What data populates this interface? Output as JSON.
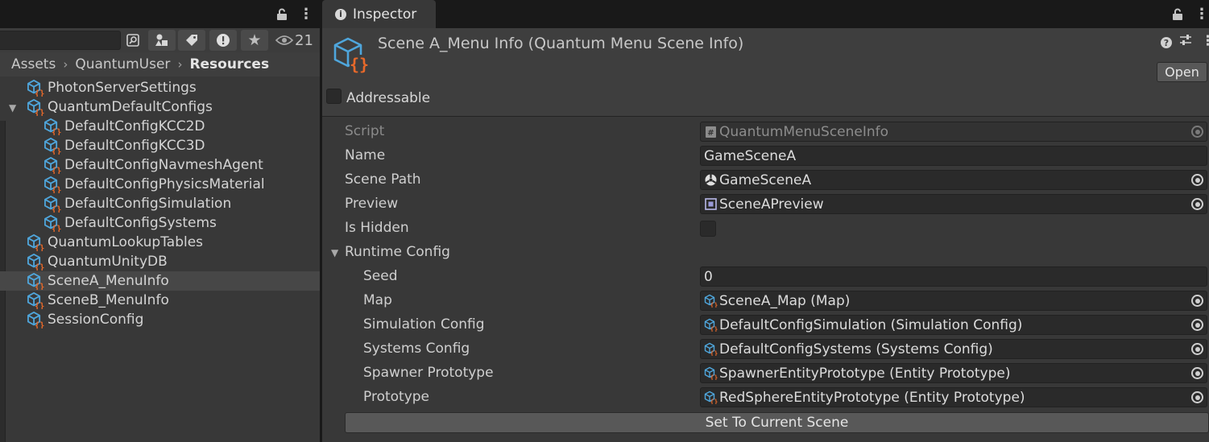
{
  "project_panel": {
    "visible_count": "21",
    "search": {
      "value": "",
      "placeholder": ""
    },
    "breadcrumb": [
      "Assets",
      "QuantumUser",
      "Resources"
    ],
    "tree": [
      {
        "label": "PhotonServerSettings",
        "depth": 0,
        "expanded": false,
        "selected": false
      },
      {
        "label": "QuantumDefaultConfigs",
        "depth": 0,
        "expanded": true,
        "selected": false
      },
      {
        "label": "DefaultConfigKCC2D",
        "depth": 1,
        "expanded": false,
        "selected": false
      },
      {
        "label": "DefaultConfigKCC3D",
        "depth": 1,
        "expanded": false,
        "selected": false
      },
      {
        "label": "DefaultConfigNavmeshAgent",
        "depth": 1,
        "expanded": false,
        "selected": false
      },
      {
        "label": "DefaultConfigPhysicsMaterial",
        "depth": 1,
        "expanded": false,
        "selected": false
      },
      {
        "label": "DefaultConfigSimulation",
        "depth": 1,
        "expanded": false,
        "selected": false
      },
      {
        "label": "DefaultConfigSystems",
        "depth": 1,
        "expanded": false,
        "selected": false
      },
      {
        "label": "QuantumLookupTables",
        "depth": 0,
        "expanded": false,
        "selected": false
      },
      {
        "label": "QuantumUnityDB",
        "depth": 0,
        "expanded": false,
        "selected": false
      },
      {
        "label": "SceneA_MenuInfo",
        "depth": 0,
        "expanded": false,
        "selected": true
      },
      {
        "label": "SceneB_MenuInfo",
        "depth": 0,
        "expanded": false,
        "selected": false
      },
      {
        "label": "SessionConfig",
        "depth": 0,
        "expanded": false,
        "selected": false
      }
    ]
  },
  "inspector": {
    "tab_label": "Inspector",
    "title": "Scene A_Menu Info (Quantum Menu Scene Info)",
    "open_label": "Open",
    "addressable_label": "Addressable",
    "addressable_checked": false,
    "properties": {
      "script": {
        "label": "Script",
        "value": "QuantumMenuSceneInfo",
        "icon": "script-icon"
      },
      "name": {
        "label": "Name",
        "value": "GameSceneA"
      },
      "scene_path": {
        "label": "Scene Path",
        "value": "GameSceneA",
        "icon": "unity-scene-icon"
      },
      "preview": {
        "label": "Preview",
        "value": "SceneAPreview",
        "icon": "sprite-icon"
      },
      "is_hidden": {
        "label": "Is Hidden",
        "checked": false
      },
      "runtime_config": {
        "label": "Runtime Config",
        "expanded": true,
        "seed": {
          "label": "Seed",
          "value": "0"
        },
        "map": {
          "label": "Map",
          "value": "SceneA_Map (Map)",
          "icon": "quantum-asset-icon"
        },
        "simulation_config": {
          "label": "Simulation Config",
          "value": "DefaultConfigSimulation (Simulation Config)",
          "icon": "quantum-asset-icon"
        },
        "systems_config": {
          "label": "Systems Config",
          "value": "DefaultConfigSystems (Systems Config)",
          "icon": "quantum-asset-icon"
        },
        "spawner_prototype": {
          "label": "Spawner Prototype",
          "value": "SpawnerEntityPrototype (Entity Prototype)",
          "icon": "quantum-asset-icon"
        },
        "prototype": {
          "label": "Prototype",
          "value": "RedSphereEntityPrototype (Entity Prototype)",
          "icon": "quantum-asset-icon"
        }
      }
    },
    "set_current_scene_label": "Set To Current Scene"
  },
  "colors": {
    "panel_bg": "#383838",
    "tabbar_bg": "#191919",
    "field_bg": "#2a2a2a",
    "selected_row": "#474747",
    "button_bg": "#585858",
    "asset_icon_blue": "#4fa6dc",
    "asset_icon_orange": "#e8692a"
  }
}
